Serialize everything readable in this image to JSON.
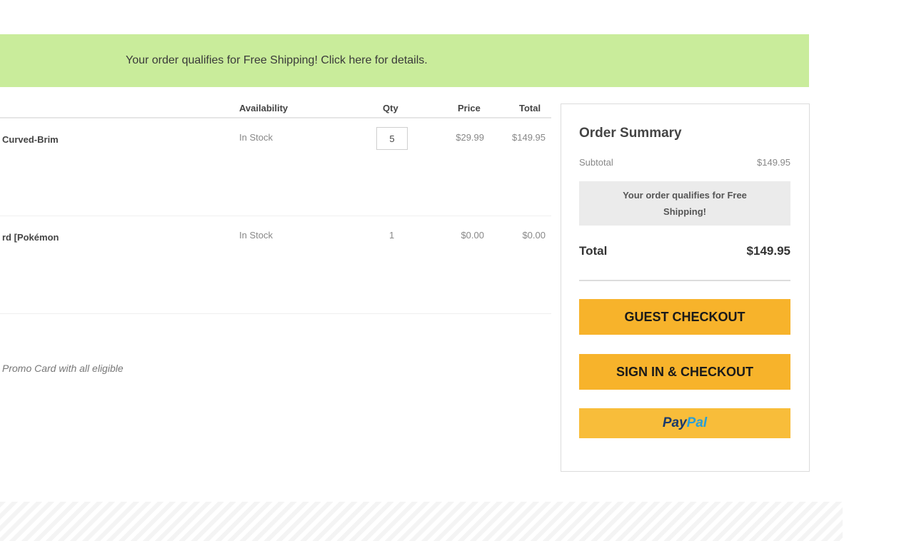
{
  "banner": {
    "text": "Your order qualifies for Free Shipping! Click here for details."
  },
  "cart": {
    "columns": {
      "availability": "Availability",
      "qty": "Qty",
      "price": "Price",
      "total": "Total"
    },
    "items": [
      {
        "name": "Curved-Brim",
        "availability": "In Stock",
        "qty": "5",
        "price": "$29.99",
        "total": "$149.95"
      },
      {
        "name": "rd [Pokémon",
        "availability": "In Stock",
        "qty": "1",
        "price": "$0.00",
        "total": "$0.00"
      }
    ],
    "promo_note": "Promo Card with all eligible"
  },
  "summary": {
    "title": "Order Summary",
    "subtotal_label": "Subtotal",
    "subtotal_value": "$149.95",
    "free_shipping_text": "Your order qualifies for Free Shipping!",
    "total_label": "Total",
    "total_value": "$149.95",
    "guest_checkout_label": "GUEST CHECKOUT",
    "signin_checkout_label": "SIGN IN & CHECKOUT",
    "paypal_pay": "Pay",
    "paypal_pal": "Pal"
  },
  "colors": {
    "banner_bg": "#c9ec9b",
    "button_bg": "#f7b32b",
    "paypal_dark": "#1b3a6b",
    "paypal_light": "#2a9fd6"
  }
}
